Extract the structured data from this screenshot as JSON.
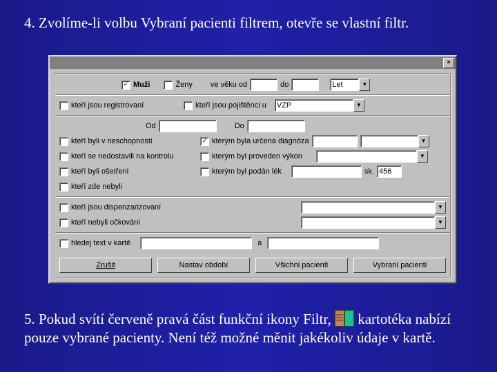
{
  "caption_top": "4. Zvolíme-li volbu Vybraní pacienti filtrem, otevře se vlastní filtr.",
  "caption_bottom_1": "5. Pokud svítí červeně pravá část funkční ikony Filtr, ",
  "caption_bottom_2": " kartotéka nabízí pouze vybrané pacienty. Není též možné měnit jakékoliv údaje v kartě.",
  "row1": {
    "muzi": "Muži",
    "zeny": "Ženy",
    "ve_veku_od": "ve věku od",
    "do": "do",
    "let": "Let"
  },
  "row2": {
    "registrovani": "kteří jsou registrovaní",
    "pojistenci": "kteří jsou pojištěnci u",
    "vzp": "VZP"
  },
  "row3": {
    "od": "Od",
    "do": "Do"
  },
  "row4": {
    "neschopnost": "kteří byli v neschopnosti",
    "diagnoza": "kterým byla určena diagnóza"
  },
  "row5": {
    "kontrola": "kteří se nedostavili na kontrolu",
    "vykon": "kterým byl proveden výkon"
  },
  "row6": {
    "osetren": "kteří byli ošetřeni",
    "lek": "kterým byl podán lék",
    "sk": "sk.",
    "sk_val": "456"
  },
  "row7": {
    "nebyli": "kteří zde nebyli"
  },
  "row8": {
    "dispenz": "kteří jsou dispenzarizovaní"
  },
  "row9": {
    "ockovani": "kteří nebyli očkováni"
  },
  "row10": {
    "hledej": "hledej text v kartě",
    "a": "a"
  },
  "buttons": {
    "zrusit": "Zrušit",
    "nastav": "Nastav období",
    "vsichni": "Všichni pacienti",
    "vybrani": "Vybraní pacienti"
  }
}
